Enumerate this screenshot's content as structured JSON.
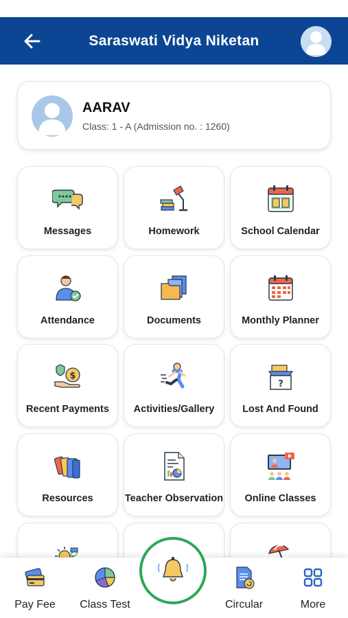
{
  "header": {
    "title": "Saraswati Vidya Niketan",
    "back_icon": "arrow-left-icon",
    "avatar_icon": "user-avatar-icon",
    "background": "#0c4593"
  },
  "profile": {
    "name": "AARAV",
    "class_info": "Class: 1 - A (Admission no. : 1260)"
  },
  "tiles": [
    {
      "label": "Messages",
      "icon": "chat-bubbles-icon"
    },
    {
      "label": "Homework",
      "icon": "desk-lamp-books-icon"
    },
    {
      "label": "School Calendar",
      "icon": "calendar-book-icon"
    },
    {
      "label": "Attendance",
      "icon": "teacher-check-icon"
    },
    {
      "label": "Documents",
      "icon": "folders-icon"
    },
    {
      "label": "Monthly Planner",
      "icon": "planner-calendar-icon"
    },
    {
      "label": "Recent Payments",
      "icon": "hand-money-icon"
    },
    {
      "label": "Activities/Gallery",
      "icon": "running-kid-icon"
    },
    {
      "label": "Lost And Found",
      "icon": "lost-found-box-icon"
    },
    {
      "label": "Resources",
      "icon": "books-icon"
    },
    {
      "label": "Teacher Observation",
      "icon": "report-chart-icon"
    },
    {
      "label": "Online Classes",
      "icon": "video-class-icon"
    },
    {
      "label": "",
      "icon": "sun-plant-icon"
    },
    {
      "label": "",
      "icon": ""
    },
    {
      "label": "",
      "icon": "beach-umbrella-icon"
    }
  ],
  "bottom_nav": {
    "items": [
      {
        "label": "Pay Fee",
        "icon": "card-pay-icon"
      },
      {
        "label": "Class Test",
        "icon": "pie-chart-icon"
      },
      {
        "label": "Circular",
        "icon": "circular-document-icon"
      },
      {
        "label": "More",
        "icon": "grid-more-icon"
      }
    ],
    "center_icon": "bell-icon",
    "center_ring_color": "#2ea55a"
  }
}
